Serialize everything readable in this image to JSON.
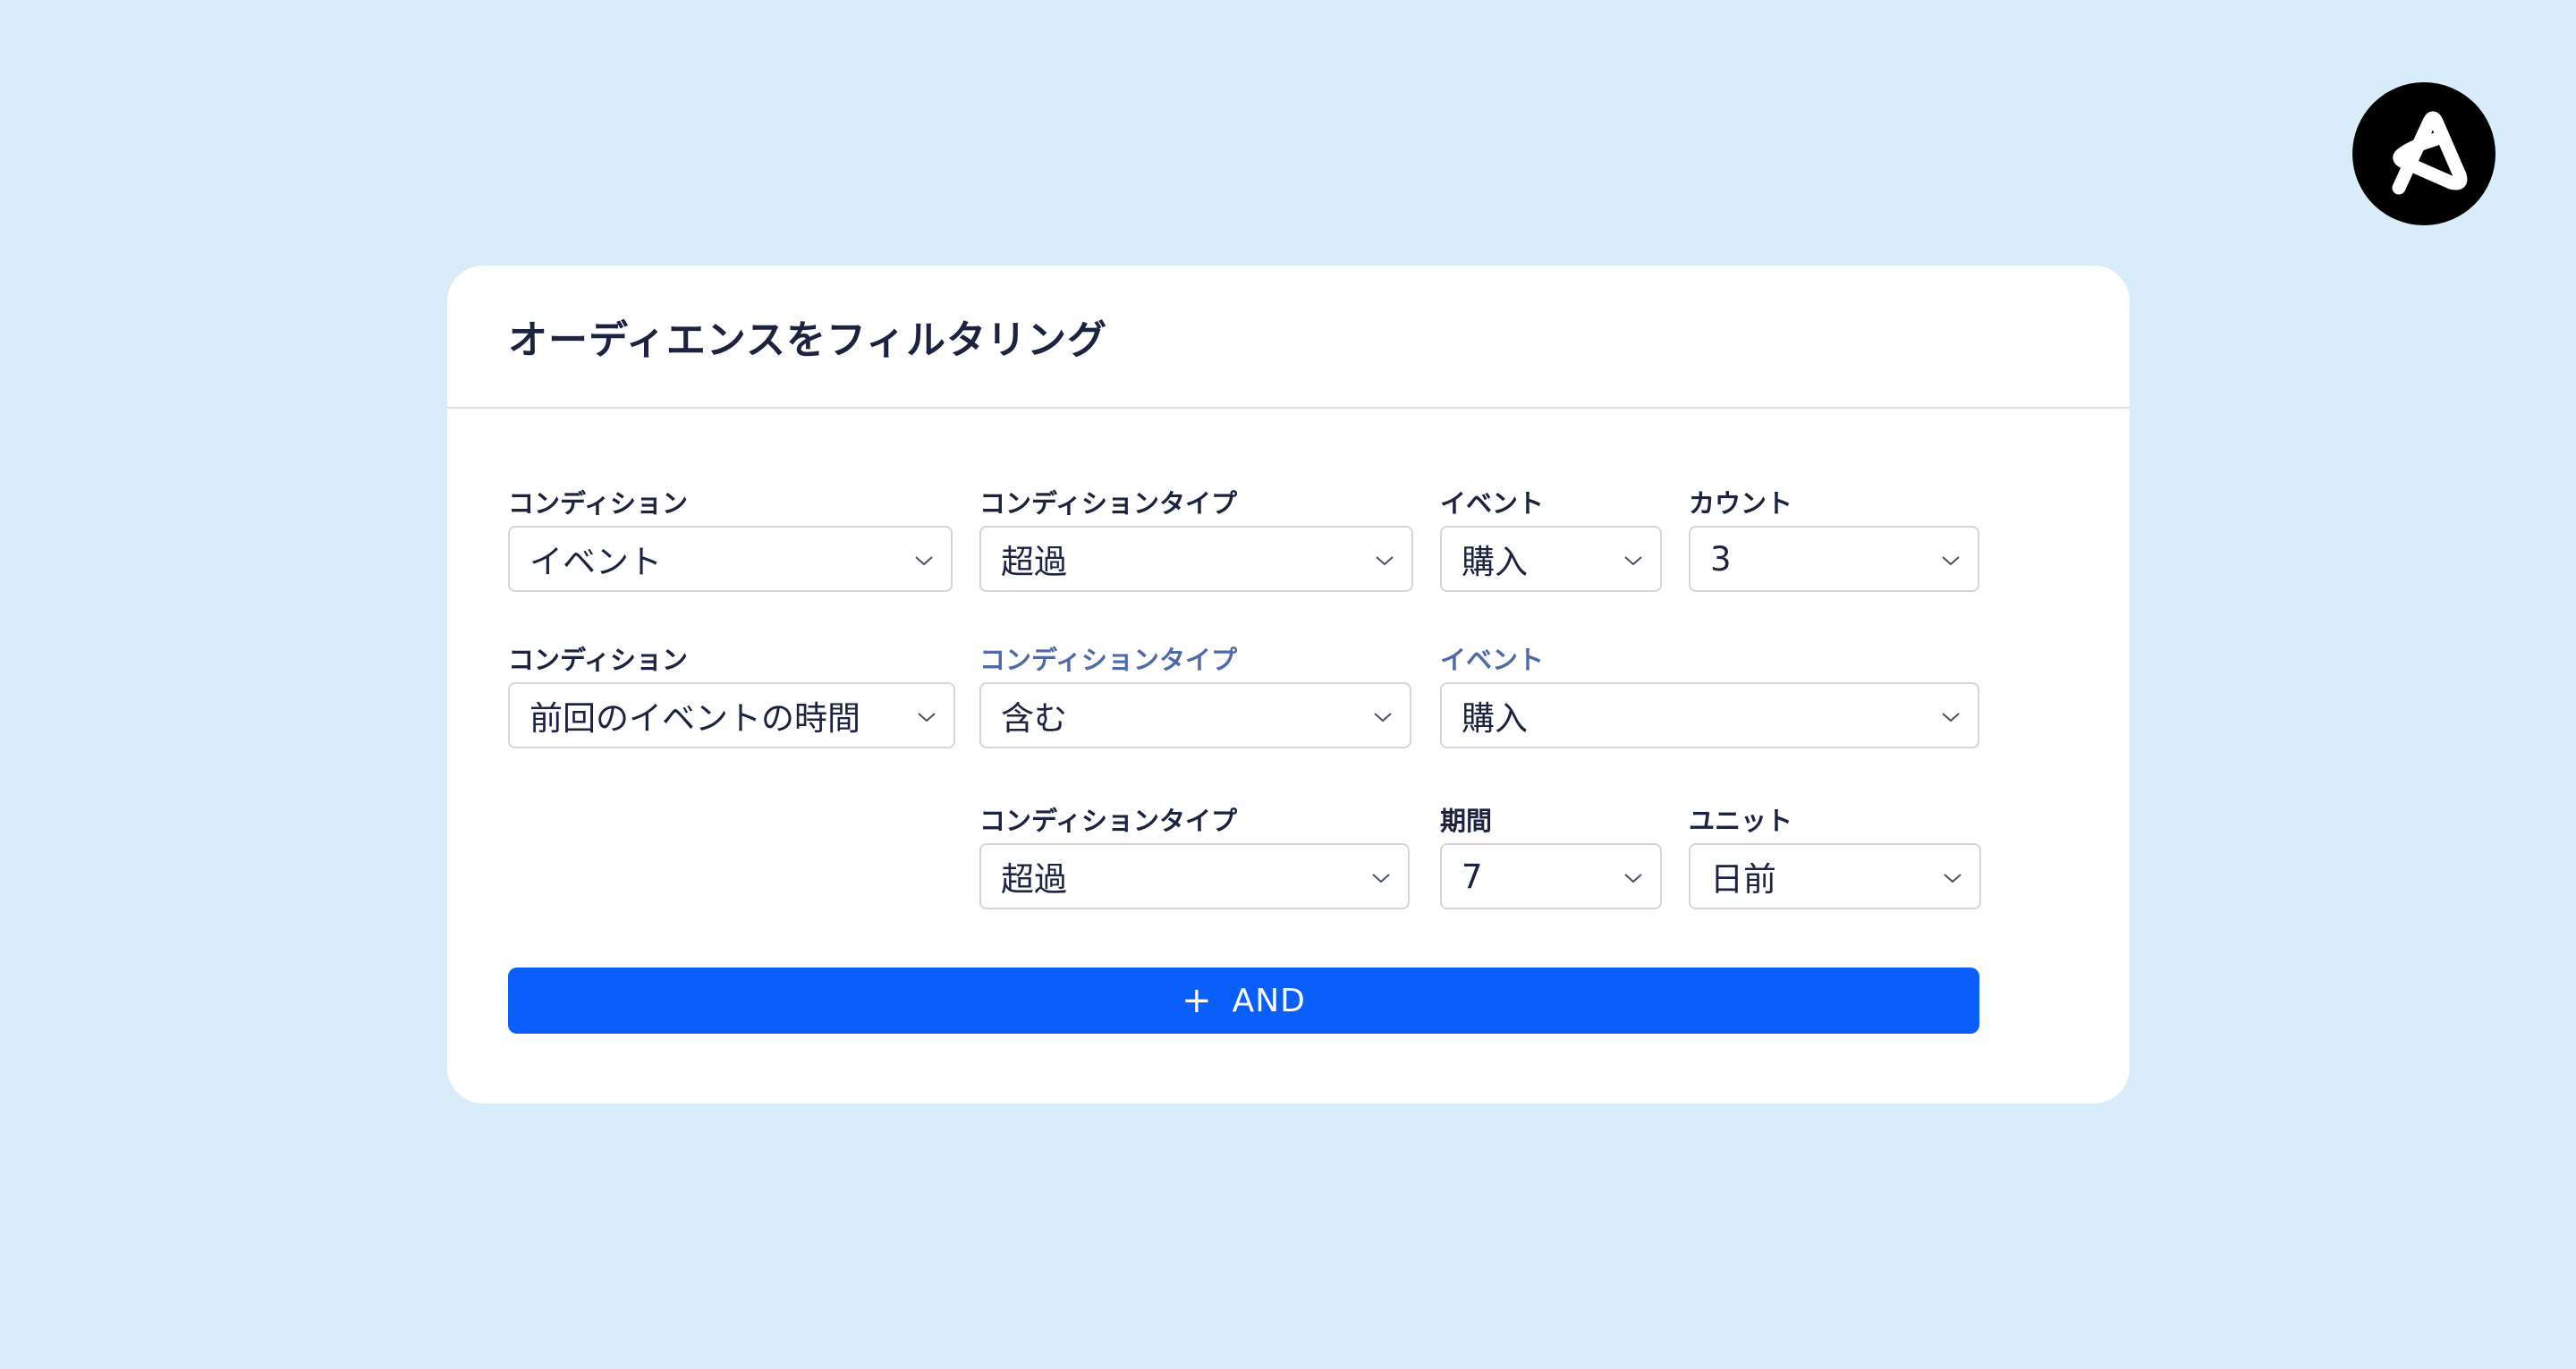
{
  "title": "オーディエンスをフィルタリング",
  "add_button": {
    "icon": "+",
    "label": "AND"
  },
  "rows": [
    {
      "fields": [
        {
          "label": "コンディション",
          "value": "イベント"
        },
        {
          "label": "コンディションタイプ",
          "value": "超過"
        },
        {
          "label": "イベント",
          "value": "購入"
        },
        {
          "label": "カウント",
          "value": "3"
        }
      ]
    },
    {
      "fields": [
        {
          "label": "コンディション",
          "value": "前回のイベントの時間"
        },
        {
          "label": "コンディションタイプ",
          "value": "含む"
        },
        {
          "label": "イベント",
          "value": "購入"
        }
      ]
    },
    {
      "fields": [
        {
          "label": "コンディションタイプ",
          "value": "超過"
        },
        {
          "label": "期間",
          "value": "7"
        },
        {
          "label": "ユニット",
          "value": "日前"
        }
      ]
    }
  ],
  "colors": {
    "background": "#d9ecf9",
    "card": "#ffffff",
    "accent": "#0a5ffa",
    "label_muted": "#4f6aa8",
    "text": "#1b2340"
  },
  "icons": {
    "logo": "brand-logo-icon",
    "dropdown": "chevron-down-icon"
  }
}
